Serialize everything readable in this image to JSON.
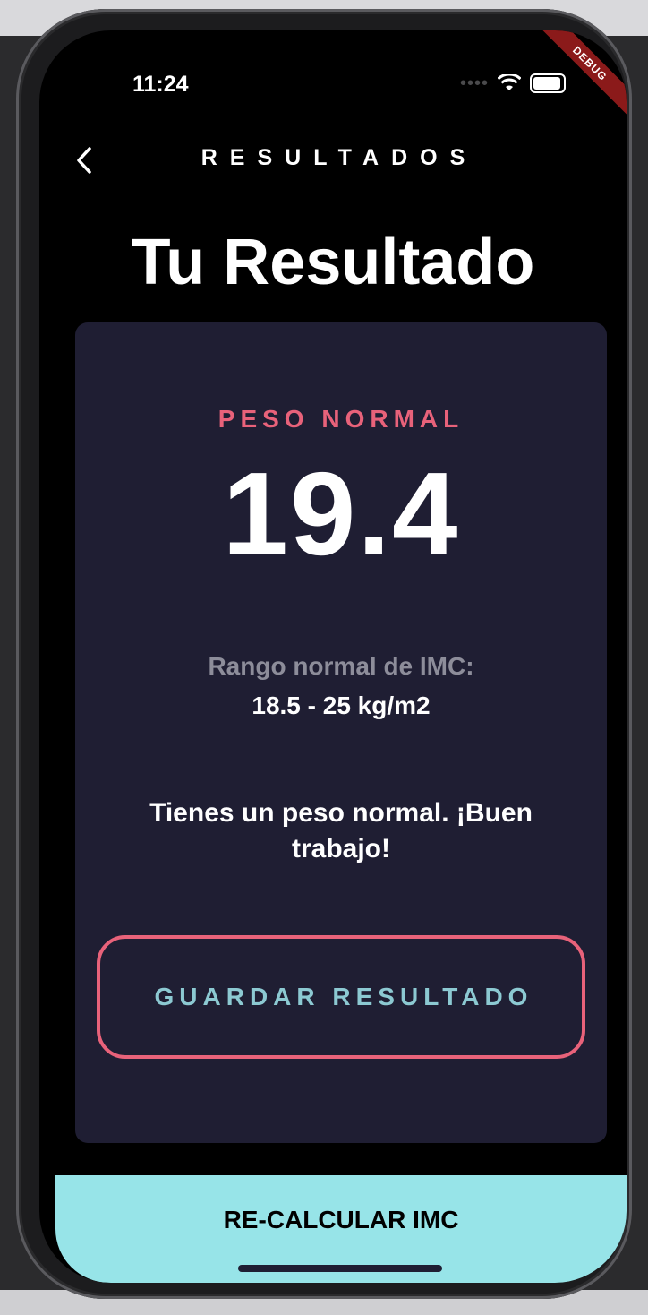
{
  "status_bar": {
    "time": "11:24",
    "debug_banner": "DEBUG"
  },
  "app_bar": {
    "title": "RESULTADOS",
    "back_icon": "chevron-left-icon"
  },
  "page_title": "Tu Resultado",
  "result": {
    "category": "PESO NORMAL",
    "bmi": "19.4",
    "range_label": "Rango normal de IMC:",
    "range_value": "18.5 - 25 kg/m2",
    "message": "Tienes un peso normal. ¡Buen trabajo!"
  },
  "buttons": {
    "save": "GUARDAR RESULTADO",
    "recalculate": "RE-CALCULAR IMC"
  },
  "colors": {
    "accent_pink": "#e8627a",
    "card_bg": "#1f1e33",
    "bottom_button": "#97e4e8",
    "save_text": "#8cc9d2"
  }
}
